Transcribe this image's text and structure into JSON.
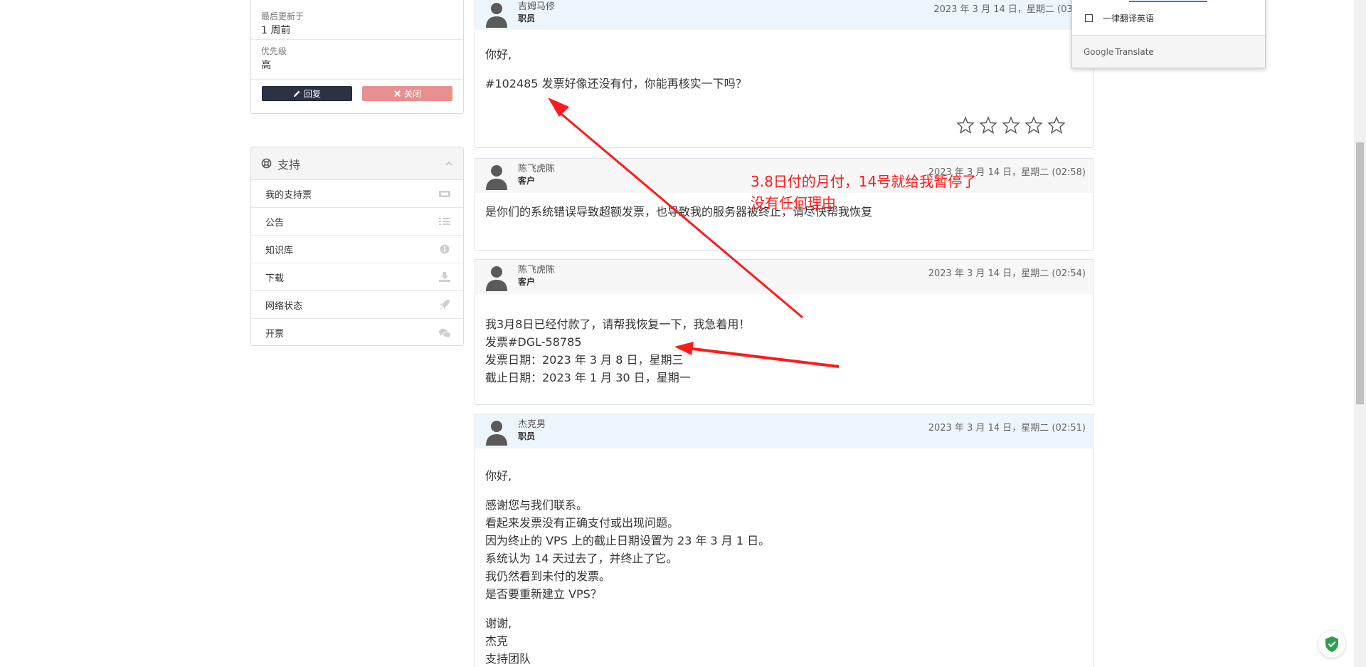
{
  "ticket": {
    "last_updated_label": "最后更新于",
    "last_updated_value": "1 周前",
    "priority_label": "优先级",
    "priority_value": "高",
    "reply_label": "回复",
    "close_label": "关闭"
  },
  "support": {
    "title": "支持",
    "items": [
      {
        "label": "我的支持票",
        "icon": "ticket-icon"
      },
      {
        "label": "公告",
        "icon": "list-icon"
      },
      {
        "label": "知识库",
        "icon": "info-icon"
      },
      {
        "label": "下载",
        "icon": "download-icon"
      },
      {
        "label": "网络状态",
        "icon": "rocket-icon"
      },
      {
        "label": "开票",
        "icon": "comments-icon"
      }
    ]
  },
  "messages": [
    {
      "name": "吉姆马修",
      "role": "职员",
      "date": "2023 年 3 月 14 日，星期二 (03:",
      "lines": [
        "你好,",
        "#102485 发票好像还没有付，你能再核实一下吗？"
      ]
    },
    {
      "name": "陈飞虎陈",
      "role": "客户",
      "date": "2023 年 3 月 14 日，星期二 (02:58)",
      "lines": [
        "是你们的系统错误导致超额发票，也导致我的服务器被终止，请尽快帮我恢复"
      ]
    },
    {
      "name": "陈飞虎陈",
      "role": "客户",
      "date": "2023 年 3 月 14 日，星期二 (02:54)",
      "lines": [
        "我3月8日已经付款了，请帮我恢复一下，我急着用！",
        "发票#DGL-58785",
        "发票日期：2023 年 3 月 8 日，星期三",
        "截止日期：2023 年 1 月 30 日，星期一"
      ]
    },
    {
      "name": "杰克男",
      "role": "职员",
      "date": "2023 年 3 月 14 日，星期二 (02:51)",
      "greeting": "你好,",
      "lines": [
        "感谢您与我们联系。",
        "看起来发票没有正确支付或出现问题。",
        "因为终止的 VPS 上的截止日期设置为 23 年 3 月 1 日。",
        "系统认为 14 天过去了，并终止了它。",
        "我仍然看到未付的发票。",
        "是否要重新建立 VPS？"
      ],
      "closing": [
        "谢谢,",
        "杰克",
        "支持团队"
      ]
    }
  ],
  "annotation": {
    "line1": "3.8日付的月付，14号就给我暂停了",
    "line2": "没有任何理由",
    "color": "#ff1a1a"
  },
  "translate": {
    "always_translate_label": "一律翻译英语",
    "brand_google": "Google",
    "brand_translate": "Translate"
  }
}
